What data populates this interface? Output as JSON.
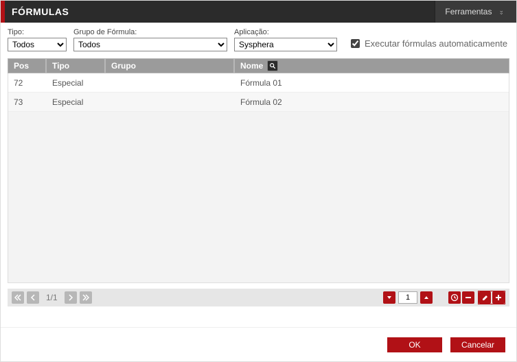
{
  "header": {
    "title": "FÓRMULAS",
    "tools_label": "Ferramentas"
  },
  "filters": {
    "tipo": {
      "label": "Tipo:",
      "value": "Todos",
      "options": [
        "Todos"
      ]
    },
    "grupo": {
      "label": "Grupo de Fórmula:",
      "value": "Todos",
      "options": [
        "Todos"
      ]
    },
    "aplicacao": {
      "label": "Aplicação:",
      "value": "Sysphera",
      "options": [
        "Sysphera"
      ]
    },
    "auto_exec": {
      "label": "Executar fórmulas automaticamente",
      "checked": true
    }
  },
  "table": {
    "headers": {
      "pos": "Pos",
      "tipo": "Tipo",
      "grupo": "Grupo",
      "nome": "Nome"
    },
    "rows": [
      {
        "pos": "72",
        "tipo": "Especial",
        "grupo": "",
        "nome": "Fórmula 01"
      },
      {
        "pos": "73",
        "tipo": "Especial",
        "grupo": "",
        "nome": "Fórmula 02"
      }
    ]
  },
  "pager": {
    "page_text": "1/1",
    "page_input": "1"
  },
  "footer": {
    "ok": "OK",
    "cancel": "Cancelar"
  }
}
